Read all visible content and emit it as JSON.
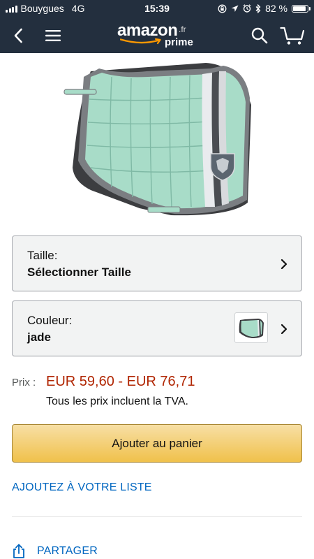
{
  "status_bar": {
    "carrier": "Bouygues",
    "network": "4G",
    "time": "15:39",
    "battery_percent": "82 %",
    "battery_level": 0.82
  },
  "nav": {
    "logo_word": "amazon",
    "logo_tld": ".fr",
    "logo_sub": "prime"
  },
  "options": {
    "size": {
      "label": "Taille:",
      "value": "Sélectionner Taille"
    },
    "color": {
      "label": "Couleur:",
      "value": "jade"
    }
  },
  "price": {
    "label": "Prix :",
    "value": "EUR 59,60 - EUR 76,71",
    "tax_note": "Tous les prix incluent la TVA."
  },
  "actions": {
    "add_to_cart": "Ajouter au panier",
    "add_to_list": "AJOUTEZ À VOTRE LISTE",
    "share": "PARTAGER"
  },
  "colors": {
    "header_bg": "#232f3e",
    "price": "#b12704",
    "link": "#0066c0",
    "button": "#f0c14b",
    "product": "#a8dcc8"
  },
  "icons": {
    "back": "back-arrow-icon",
    "menu": "hamburger-menu-icon",
    "search": "search-icon",
    "cart": "cart-icon",
    "share": "share-icon"
  }
}
